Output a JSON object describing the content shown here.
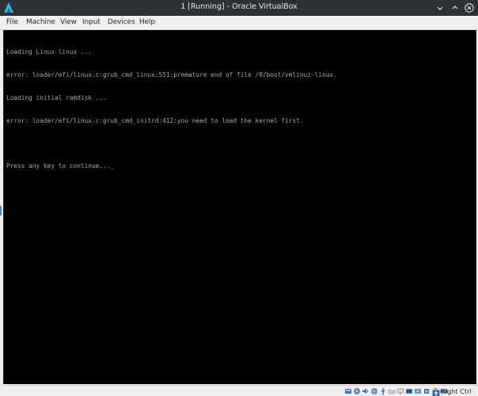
{
  "window": {
    "title": "1 [Running] - Oracle VirtualBox"
  },
  "menu": {
    "file": "File",
    "machine": "Machine",
    "view": "View",
    "input": "Input",
    "devices": "Devices",
    "help": "Help"
  },
  "console": {
    "lines": [
      "Loading Linux linux ...",
      "error: loader/efi/linux.c:grub_cmd_linux:551:premature end of file /0/boot/vmlinuz-linux.",
      "Loading initial ramdisk ...",
      "error: loader/efi/linux.c:grub_cmd_initrd:412:you need to load the kernel first.",
      "",
      "Press any key to continue..."
    ],
    "cursor": "_",
    "text_color": "#aaaaaa",
    "background": "#000000"
  },
  "statusbar": {
    "icons": [
      "hard-disk-icon",
      "optical-drive-icon",
      "audio-icon",
      "network-icon",
      "usb-icon",
      "shared-folders-icon",
      "display-icon",
      "recording-icon",
      "vrde-icon",
      "cpu-icon",
      "mouse-integration-icon",
      "keyboard-icon"
    ],
    "host_key": "Right Ctrl"
  },
  "colors": {
    "titlebar": "#2d3136",
    "menubar": "#eff0f1",
    "accent": "#3d8be0"
  }
}
